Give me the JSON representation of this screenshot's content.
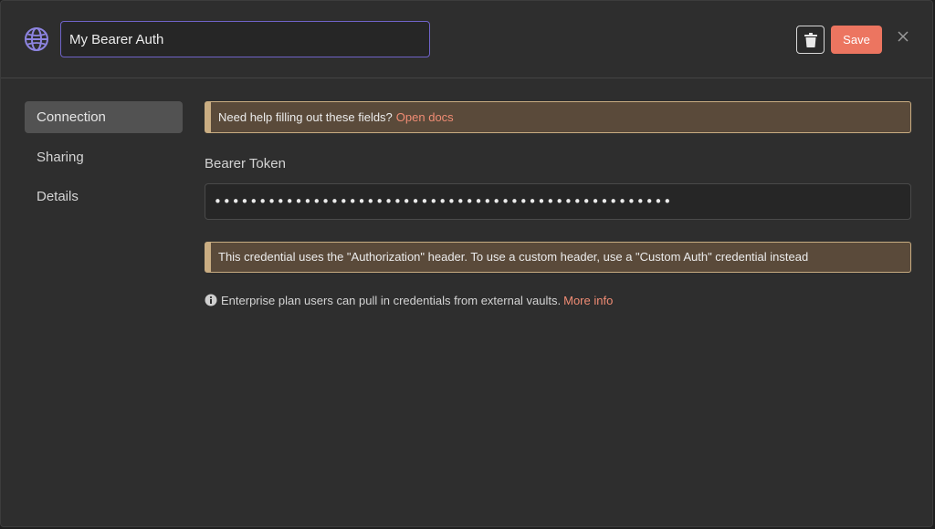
{
  "header": {
    "credential_name": "My Bearer Auth",
    "icon": "globe-icon",
    "delete_icon": "trash-icon",
    "save_label": "Save",
    "close_icon": "close-icon"
  },
  "sidebar": {
    "items": [
      {
        "label": "Connection",
        "active": true
      },
      {
        "label": "Sharing",
        "active": false
      },
      {
        "label": "Details",
        "active": false
      }
    ]
  },
  "main": {
    "help_callout": {
      "text": "Need help filling out these fields?",
      "link": "Open docs"
    },
    "token_field": {
      "label": "Bearer Token",
      "value": "•••••••••••••••••••••••••••••••••••••••••••••••••••"
    },
    "header_callout": {
      "text": "This credential uses the \"Authorization\" header. To use a custom header, use a \"Custom Auth\" credential instead"
    },
    "vault_info": {
      "icon": "info-icon",
      "text": "Enterprise plan users can pull in credentials from external vaults.",
      "link": "More info"
    }
  },
  "colors": {
    "accent": "#ec7560",
    "link": "#f08c74",
    "input_focus_border": "#6f63c7",
    "icon_purple": "#8d84e0",
    "callout_bg": "#5a4a3a",
    "callout_border": "#c9ad82"
  }
}
